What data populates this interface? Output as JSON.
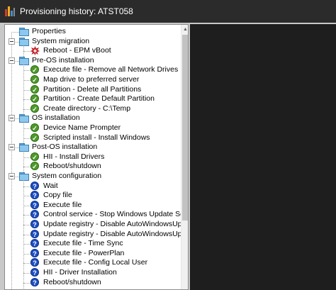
{
  "window": {
    "title": "Provisioning history: ATST058"
  },
  "icons": {
    "app": "app-logo-icon",
    "folder": "folder-icon",
    "success": "success-check-icon",
    "pending": "pending-question-icon",
    "error": "error-burst-icon",
    "collapse": "collapse-minus-icon"
  },
  "colors": {
    "success": "#4e9a2a",
    "pending": "#1d4fc4",
    "error": "#c0171c",
    "folder": "#8cc8ee"
  },
  "tree": {
    "items": [
      {
        "label": "Properties",
        "level": 0,
        "icon": "folder",
        "expander": false
      },
      {
        "label": "System migration",
        "level": 0,
        "icon": "folder",
        "expander": true
      },
      {
        "label": "Reboot - EPM vBoot",
        "level": 1,
        "icon": "error"
      },
      {
        "label": "Pre-OS installation",
        "level": 0,
        "icon": "folder",
        "expander": true
      },
      {
        "label": "Execute file - Remove all Network Drives",
        "level": 1,
        "icon": "success"
      },
      {
        "label": "Map drive to preferred server",
        "level": 1,
        "icon": "success"
      },
      {
        "label": "Partition - Delete all Partitions",
        "level": 1,
        "icon": "success"
      },
      {
        "label": "Partition - Create Default Partition",
        "level": 1,
        "icon": "success"
      },
      {
        "label": "Create directory - C:\\Temp",
        "level": 1,
        "icon": "success"
      },
      {
        "label": "OS installation",
        "level": 0,
        "icon": "folder",
        "expander": true
      },
      {
        "label": "Device Name Prompter",
        "level": 1,
        "icon": "success"
      },
      {
        "label": "Scripted install - Install Windows",
        "level": 1,
        "icon": "success"
      },
      {
        "label": "Post-OS installation",
        "level": 0,
        "icon": "folder",
        "expander": true
      },
      {
        "label": "HII - Install Drivers",
        "level": 1,
        "icon": "success"
      },
      {
        "label": "Reboot/shutdown",
        "level": 1,
        "icon": "success"
      },
      {
        "label": "System configuration",
        "level": 0,
        "icon": "folder",
        "expander": true
      },
      {
        "label": "Wait",
        "level": 1,
        "icon": "pending"
      },
      {
        "label": "Copy file",
        "level": 1,
        "icon": "pending"
      },
      {
        "label": "Execute file",
        "level": 1,
        "icon": "pending"
      },
      {
        "label": "Control service - Stop Windows Update Servic",
        "level": 1,
        "icon": "pending"
      },
      {
        "label": "Update registry - Disable AutoWindowsUpdate",
        "level": 1,
        "icon": "pending"
      },
      {
        "label": "Update registry - Disable AutoWindowsUpdate",
        "level": 1,
        "icon": "pending"
      },
      {
        "label": "Execute file - Time Sync",
        "level": 1,
        "icon": "pending"
      },
      {
        "label": "Execute file - PowerPlan",
        "level": 1,
        "icon": "pending"
      },
      {
        "label": "Execute file - Config Local User",
        "level": 1,
        "icon": "pending"
      },
      {
        "label": "HII - Driver Installation",
        "level": 1,
        "icon": "pending"
      },
      {
        "label": "Reboot/shutdown",
        "level": 1,
        "icon": "pending"
      }
    ]
  }
}
